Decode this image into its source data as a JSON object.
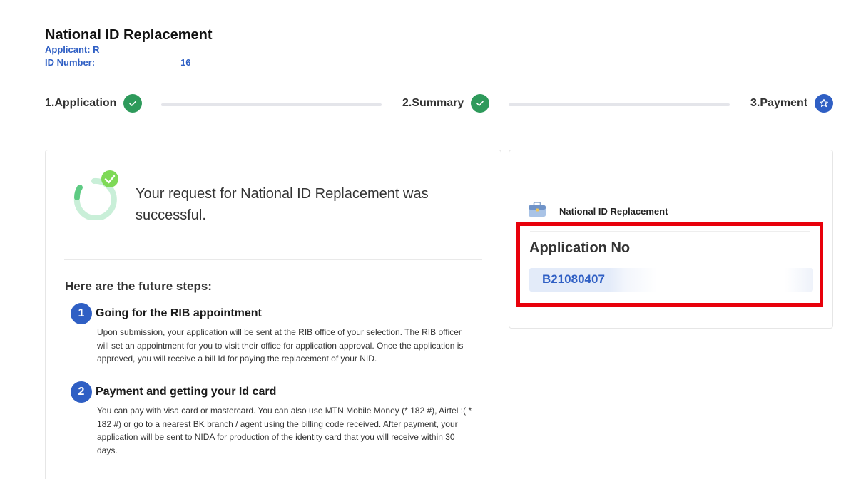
{
  "header": {
    "title": "National ID Replacement",
    "applicant_label": "Applicant: R",
    "id_number_label": "ID Number:",
    "id_number_tail": "16"
  },
  "stepper": {
    "steps": [
      {
        "label": "1.Application",
        "status": "complete",
        "icon": "check-icon"
      },
      {
        "label": "2.Summary",
        "status": "complete",
        "icon": "check-icon"
      },
      {
        "label": "3.Payment",
        "status": "current",
        "icon": "star-icon"
      }
    ]
  },
  "result": {
    "message": "Your request for National ID Replacement was successful.",
    "steps_heading": "Here are the future steps:",
    "future_steps": [
      {
        "number": "1",
        "title": "Going for the RIB appointment",
        "body": "Upon submission, your application will be sent at the RIB office of your selection. The RIB officer will set an appointment for you to visit their office for application approval. Once the application is approved, you will receive a bill Id for paying the replacement of your NID."
      },
      {
        "number": "2",
        "title": "Payment and getting your Id card",
        "body": "You can pay with visa card or mastercard. You can also use MTN Mobile Money (* 182 #), Airtel :( * 182 #) or go to a nearest BK branch / agent using the billing code received. After payment, your application will be sent to NIDA for production of the identity card that you will receive within 30 days."
      }
    ]
  },
  "application": {
    "service_name": "National ID Replacement",
    "service_icon": "briefcase-icon",
    "number_label": "Application No",
    "number_value": "B21080407"
  },
  "colors": {
    "accent_blue": "#2f5fc4",
    "success_green": "#2e9a5b",
    "highlight_red": "#e8000b"
  }
}
